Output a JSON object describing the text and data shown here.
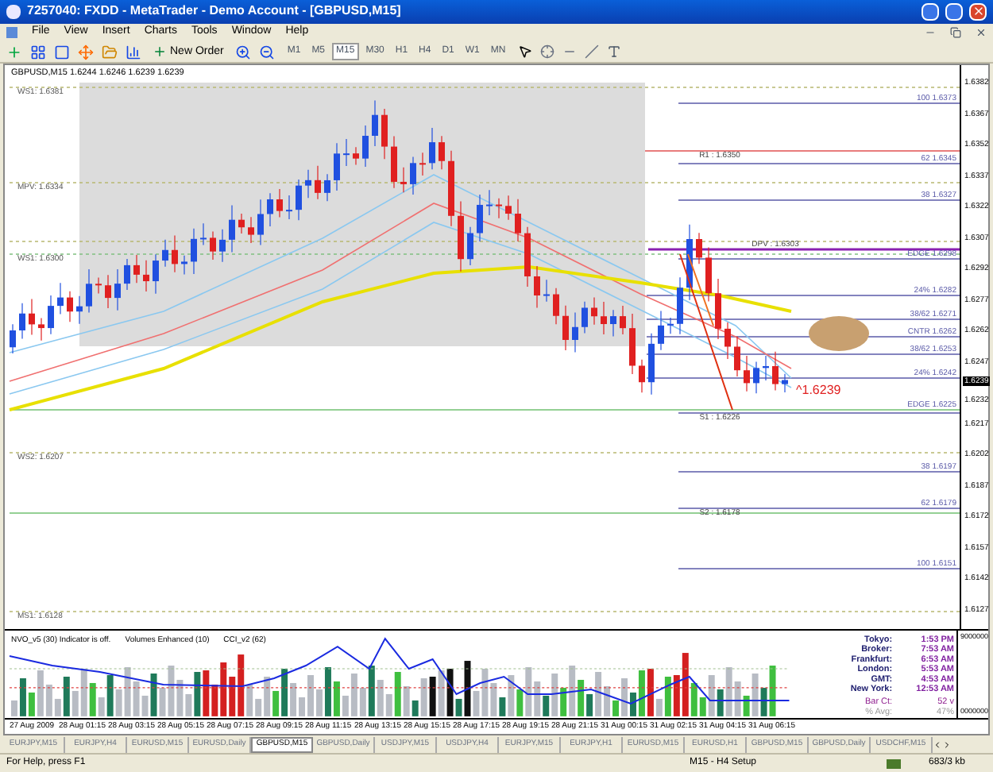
{
  "window": {
    "title": "7257040: FXDD - MetaTrader - Demo Account - [GBPUSD,M15]"
  },
  "menu": [
    "File",
    "View",
    "Insert",
    "Charts",
    "Tools",
    "Window",
    "Help"
  ],
  "toolbar": {
    "new_order": "New Order",
    "timeframes": [
      {
        "label": "M1",
        "selected": false
      },
      {
        "label": "M5",
        "selected": false
      },
      {
        "label": "M15",
        "selected": true
      },
      {
        "label": "M30",
        "selected": false
      },
      {
        "label": "H1",
        "selected": false
      },
      {
        "label": "H4",
        "selected": false
      },
      {
        "label": "D1",
        "selected": false
      },
      {
        "label": "W1",
        "selected": false
      },
      {
        "label": "MN",
        "selected": false
      }
    ]
  },
  "chart": {
    "info": "GBPUSD,M15  1.6244 1.6246 1.6239 1.6239",
    "left_labels": [
      "WS1: 1.6381",
      "MPV: 1.6334",
      "WS1: 1.6300",
      "WS2: 1.6207",
      "MS1: 1.6128"
    ],
    "level_labels": [
      {
        "text": "100  1.6373",
        "kind": "fib"
      },
      {
        "text": "R1 : 1.6350",
        "kind": "pivot"
      },
      {
        "text": "62  1.6345",
        "kind": "fib"
      },
      {
        "text": "38  1.6327",
        "kind": "fib"
      },
      {
        "text": "DPV : 1.6303",
        "kind": "pivot"
      },
      {
        "text": "EDGE  1.6298",
        "kind": "fib"
      },
      {
        "text": "24%  1.6282",
        "kind": "fib"
      },
      {
        "text": "38/62  1.6271",
        "kind": "fib"
      },
      {
        "text": "CNTR  1.6262",
        "kind": "fib"
      },
      {
        "text": "38/62  1.6253",
        "kind": "fib"
      },
      {
        "text": "24%  1.6242",
        "kind": "fib"
      },
      {
        "text": "EDGE  1.6225",
        "kind": "fib"
      },
      {
        "text": "S1 : 1.6226",
        "kind": "pivot"
      },
      {
        "text": "38  1.6197",
        "kind": "fib"
      },
      {
        "text": "62  1.6179",
        "kind": "fib"
      },
      {
        "text": "S2 : 1.6178",
        "kind": "pivot"
      },
      {
        "text": "100  1.6151",
        "kind": "fib"
      }
    ],
    "price_marker": "^1.6239",
    "price_axis": [
      {
        "text": "1.6382",
        "selected": false
      },
      {
        "text": "1.6367",
        "selected": false
      },
      {
        "text": "1.6352",
        "selected": false
      },
      {
        "text": "1.6337",
        "selected": false
      },
      {
        "text": "1.6322",
        "selected": false
      },
      {
        "text": "1.6307",
        "selected": false
      },
      {
        "text": "1.6292",
        "selected": false
      },
      {
        "text": "1.6277",
        "selected": false
      },
      {
        "text": "1.6262",
        "selected": false
      },
      {
        "text": "1.6247",
        "selected": false
      },
      {
        "text": "1.6239",
        "selected": true
      },
      {
        "text": "1.6232",
        "selected": false
      },
      {
        "text": "1.6217",
        "selected": false
      },
      {
        "text": "1.6202",
        "selected": false
      },
      {
        "text": "1.6187",
        "selected": false
      },
      {
        "text": "1.6172",
        "selected": false
      },
      {
        "text": "1.6157",
        "selected": false
      },
      {
        "text": "1.6142",
        "selected": false
      },
      {
        "text": "1.6127",
        "selected": false
      }
    ]
  },
  "indicator": {
    "headers": [
      "NVO_v5 (30) Indicator is off.",
      "Volumes Enhanced (10)",
      "CCI_v2 (62)"
    ],
    "axis": [
      "9000000",
      "0000000"
    ],
    "clocks": [
      {
        "label": "Tokyo:",
        "value": "1:53 PM"
      },
      {
        "label": "Broker:",
        "value": "7:53 AM"
      },
      {
        "label": "Frankfurt:",
        "value": "6:53 AM"
      },
      {
        "label": "London:",
        "value": "5:53 AM"
      },
      {
        "label": "GMT:",
        "value": "4:53 AM"
      },
      {
        "label": "New York:",
        "value": "12:53 AM"
      }
    ],
    "stats": [
      {
        "label": "Bar Ct:",
        "value": "52 v"
      },
      {
        "label": "% Avg:",
        "value": "47%"
      }
    ]
  },
  "time_axis": [
    "27 Aug 2009",
    "28 Aug 01:15",
    "28 Aug 03:15",
    "28 Aug 05:15",
    "28 Aug 07:15",
    "28 Aug 09:15",
    "28 Aug 11:15",
    "28 Aug 13:15",
    "28 Aug 15:15",
    "28 Aug 17:15",
    "28 Aug 19:15",
    "28 Aug 21:15",
    "31 Aug 00:15",
    "31 Aug 02:15",
    "31 Aug 04:15",
    "31 Aug 06:15"
  ],
  "tabs": [
    {
      "label": "EURJPY,M15",
      "selected": false
    },
    {
      "label": "EURJPY,H4",
      "selected": false
    },
    {
      "label": "EURUSD,M15",
      "selected": false
    },
    {
      "label": "EURUSD,Daily",
      "selected": false
    },
    {
      "label": "GBPUSD,M15",
      "selected": true
    },
    {
      "label": "GBPUSD,Daily",
      "selected": false
    },
    {
      "label": "USDJPY,M15",
      "selected": false
    },
    {
      "label": "USDJPY,H4",
      "selected": false
    },
    {
      "label": "EURJPY,M15",
      "selected": false
    },
    {
      "label": "EURJPY,H1",
      "selected": false
    },
    {
      "label": "EURUSD,M15",
      "selected": false
    },
    {
      "label": "EURUSD,H1",
      "selected": false
    },
    {
      "label": "GBPUSD,M15",
      "selected": false
    },
    {
      "label": "GBPUSD,Daily",
      "selected": false
    },
    {
      "label": "USDCHF,M15",
      "selected": false
    }
  ],
  "status_bar": {
    "help": "For Help, press F1",
    "setup": "M15 - H4 Setup",
    "traffic": "683/3 kb"
  }
}
